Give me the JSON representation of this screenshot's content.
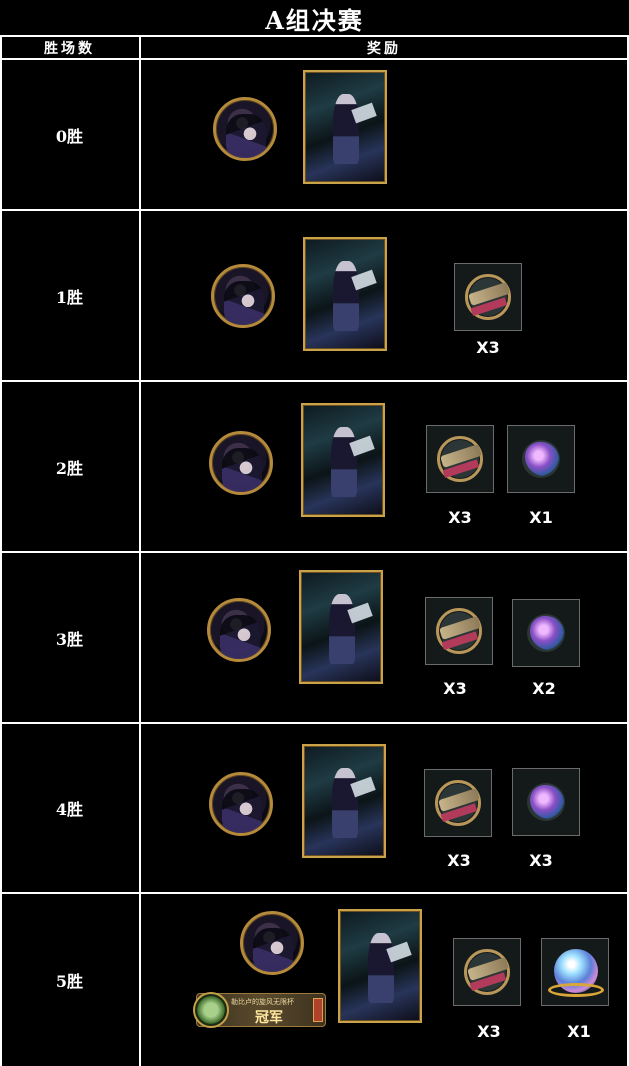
{
  "title": "A组决赛",
  "header": {
    "col1": "胜场数",
    "col2": "奖励"
  },
  "rows": [
    {
      "label": "0胜",
      "items": []
    },
    {
      "label": "1胜",
      "items": [
        {
          "icon": "gun-icon",
          "qty": "X3"
        }
      ]
    },
    {
      "label": "2胜",
      "items": [
        {
          "icon": "gun-icon",
          "qty": "X3"
        },
        {
          "icon": "gem-icon",
          "qty": "X1"
        }
      ]
    },
    {
      "label": "3胜",
      "items": [
        {
          "icon": "gun-icon",
          "qty": "X3"
        },
        {
          "icon": "gem-icon",
          "qty": "X2"
        }
      ]
    },
    {
      "label": "4胜",
      "items": [
        {
          "icon": "gun-icon",
          "qty": "X3"
        },
        {
          "icon": "gem-icon",
          "qty": "X3"
        }
      ]
    },
    {
      "label": "5胜",
      "items": [
        {
          "icon": "gun-icon",
          "qty": "X3"
        },
        {
          "icon": "orb-icon",
          "qty": "X1"
        }
      ],
      "banner": {
        "small": "勒比卢的旋风无限杯",
        "big": "冠军"
      }
    }
  ],
  "colors": {
    "background": "#000000",
    "grid": "#ffffff",
    "frame_gold": "#c9a24a"
  }
}
